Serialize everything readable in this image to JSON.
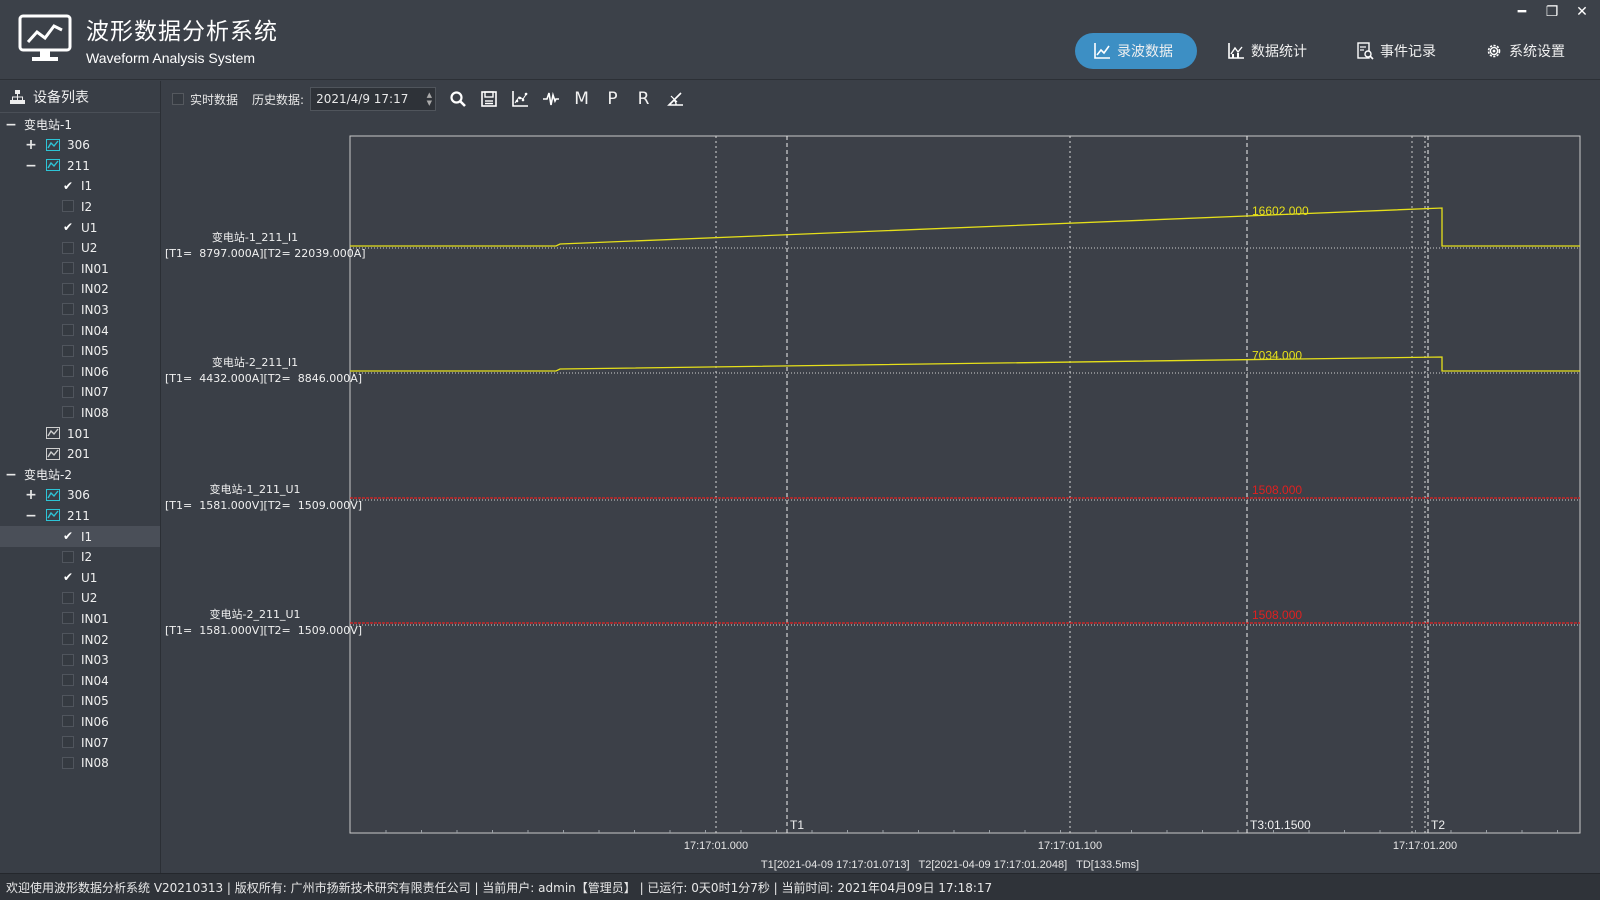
{
  "app": {
    "title": "波形数据分析系统",
    "subtitle": "Waveform Analysis System"
  },
  "nav": [
    {
      "label": "录波数据",
      "icon": "line-chart-icon",
      "active": true
    },
    {
      "label": "数据统计",
      "icon": "bar-chart-icon",
      "active": false
    },
    {
      "label": "事件记录",
      "icon": "document-search-icon",
      "active": false
    },
    {
      "label": "系统设置",
      "icon": "gear-icon",
      "active": false
    }
  ],
  "window_controls": [
    "━",
    "❐",
    "✕"
  ],
  "sidebar": {
    "title": "设备列表",
    "tree": [
      {
        "level": 0,
        "label": "变电站-1",
        "exp": "−"
      },
      {
        "level": 1,
        "label": "306",
        "exp": "+",
        "icon": "active"
      },
      {
        "level": 1,
        "label": "211",
        "exp": "−",
        "icon": "active"
      },
      {
        "level": 2,
        "label": "I1",
        "checked": true
      },
      {
        "level": 2,
        "label": "I2",
        "checked": false
      },
      {
        "level": 2,
        "label": "U1",
        "checked": true
      },
      {
        "level": 2,
        "label": "U2",
        "checked": false
      },
      {
        "level": 2,
        "label": "IN01",
        "checked": false
      },
      {
        "level": 2,
        "label": "IN02",
        "checked": false
      },
      {
        "level": 2,
        "label": "IN03",
        "checked": false
      },
      {
        "level": 2,
        "label": "IN04",
        "checked": false
      },
      {
        "level": 2,
        "label": "IN05",
        "checked": false
      },
      {
        "level": 2,
        "label": "IN06",
        "checked": false
      },
      {
        "level": 2,
        "label": "IN07",
        "checked": false
      },
      {
        "level": 2,
        "label": "IN08",
        "checked": false
      },
      {
        "level": 1,
        "label": "101",
        "icon": "inactive"
      },
      {
        "level": 1,
        "label": "201",
        "icon": "inactive"
      },
      {
        "level": 0,
        "label": "变电站-2",
        "exp": "−"
      },
      {
        "level": 1,
        "label": "306",
        "exp": "+",
        "icon": "active"
      },
      {
        "level": 1,
        "label": "211",
        "exp": "−",
        "icon": "active"
      },
      {
        "level": 2,
        "label": "I1",
        "checked": true,
        "selected": true
      },
      {
        "level": 2,
        "label": "I2",
        "checked": false
      },
      {
        "level": 2,
        "label": "U1",
        "checked": true
      },
      {
        "level": 2,
        "label": "U2",
        "checked": false
      },
      {
        "level": 2,
        "label": "IN01",
        "checked": false
      },
      {
        "level": 2,
        "label": "IN02",
        "checked": false
      },
      {
        "level": 2,
        "label": "IN03",
        "checked": false
      },
      {
        "level": 2,
        "label": "IN04",
        "checked": false
      },
      {
        "level": 2,
        "label": "IN05",
        "checked": false
      },
      {
        "level": 2,
        "label": "IN06",
        "checked": false
      },
      {
        "level": 2,
        "label": "IN07",
        "checked": false
      },
      {
        "level": 2,
        "label": "IN08",
        "checked": false
      }
    ]
  },
  "toolbar": {
    "realtime_label": "实时数据",
    "history_label": "历史数据:",
    "history_value": "2021/4/9 17:17",
    "letter_buttons": [
      "M",
      "P",
      "R"
    ]
  },
  "chart_data": {
    "type": "line",
    "x_unit": "time",
    "x_ticks": [
      "17:17:01.000",
      "17:17:01.100",
      "17:17:01.200"
    ],
    "channels": [
      {
        "name": "变电站-1_211_I1",
        "readout": "[T1=  8797.000A][T2= 22039.000A]",
        "color": "#e6e01a",
        "peak_label": "16602.000",
        "shape": "ramp"
      },
      {
        "name": "变电站-2_211_I1",
        "readout": "[T1=  4432.000A][T2=  8846.000A]",
        "color": "#e6e01a",
        "peak_label": "7034.000",
        "shape": "ramp"
      },
      {
        "name": "变电站-1_211_U1",
        "readout": "[T1=  1581.000V][T2=  1509.000V]",
        "color": "#e02020",
        "peak_label": "1508.000",
        "shape": "flat"
      },
      {
        "name": "变电站-2_211_U1",
        "readout": "[T1=  1581.000V][T2=  1509.000V]",
        "color": "#e02020",
        "peak_label": "1508.000",
        "shape": "flat"
      }
    ],
    "cursors": [
      {
        "label": "T1"
      },
      {
        "label": "T3:01.1500"
      },
      {
        "label": "T2"
      }
    ],
    "cursor_info": "T1[2021-04-09 17:17:01.0713]   T2[2021-04-09 17:17:01.2048]   TD[133.5ms]",
    "grid": true
  },
  "status": {
    "text": "欢迎使用波形数据分析系统 V20210313 | 版权所有: 广州市扬新技术研究有限责任公司 | 当前用户: admin【管理员】 | 已运行: 0天0时1分7秒 | 当前时间: 2021年04月09日 17:18:17"
  }
}
